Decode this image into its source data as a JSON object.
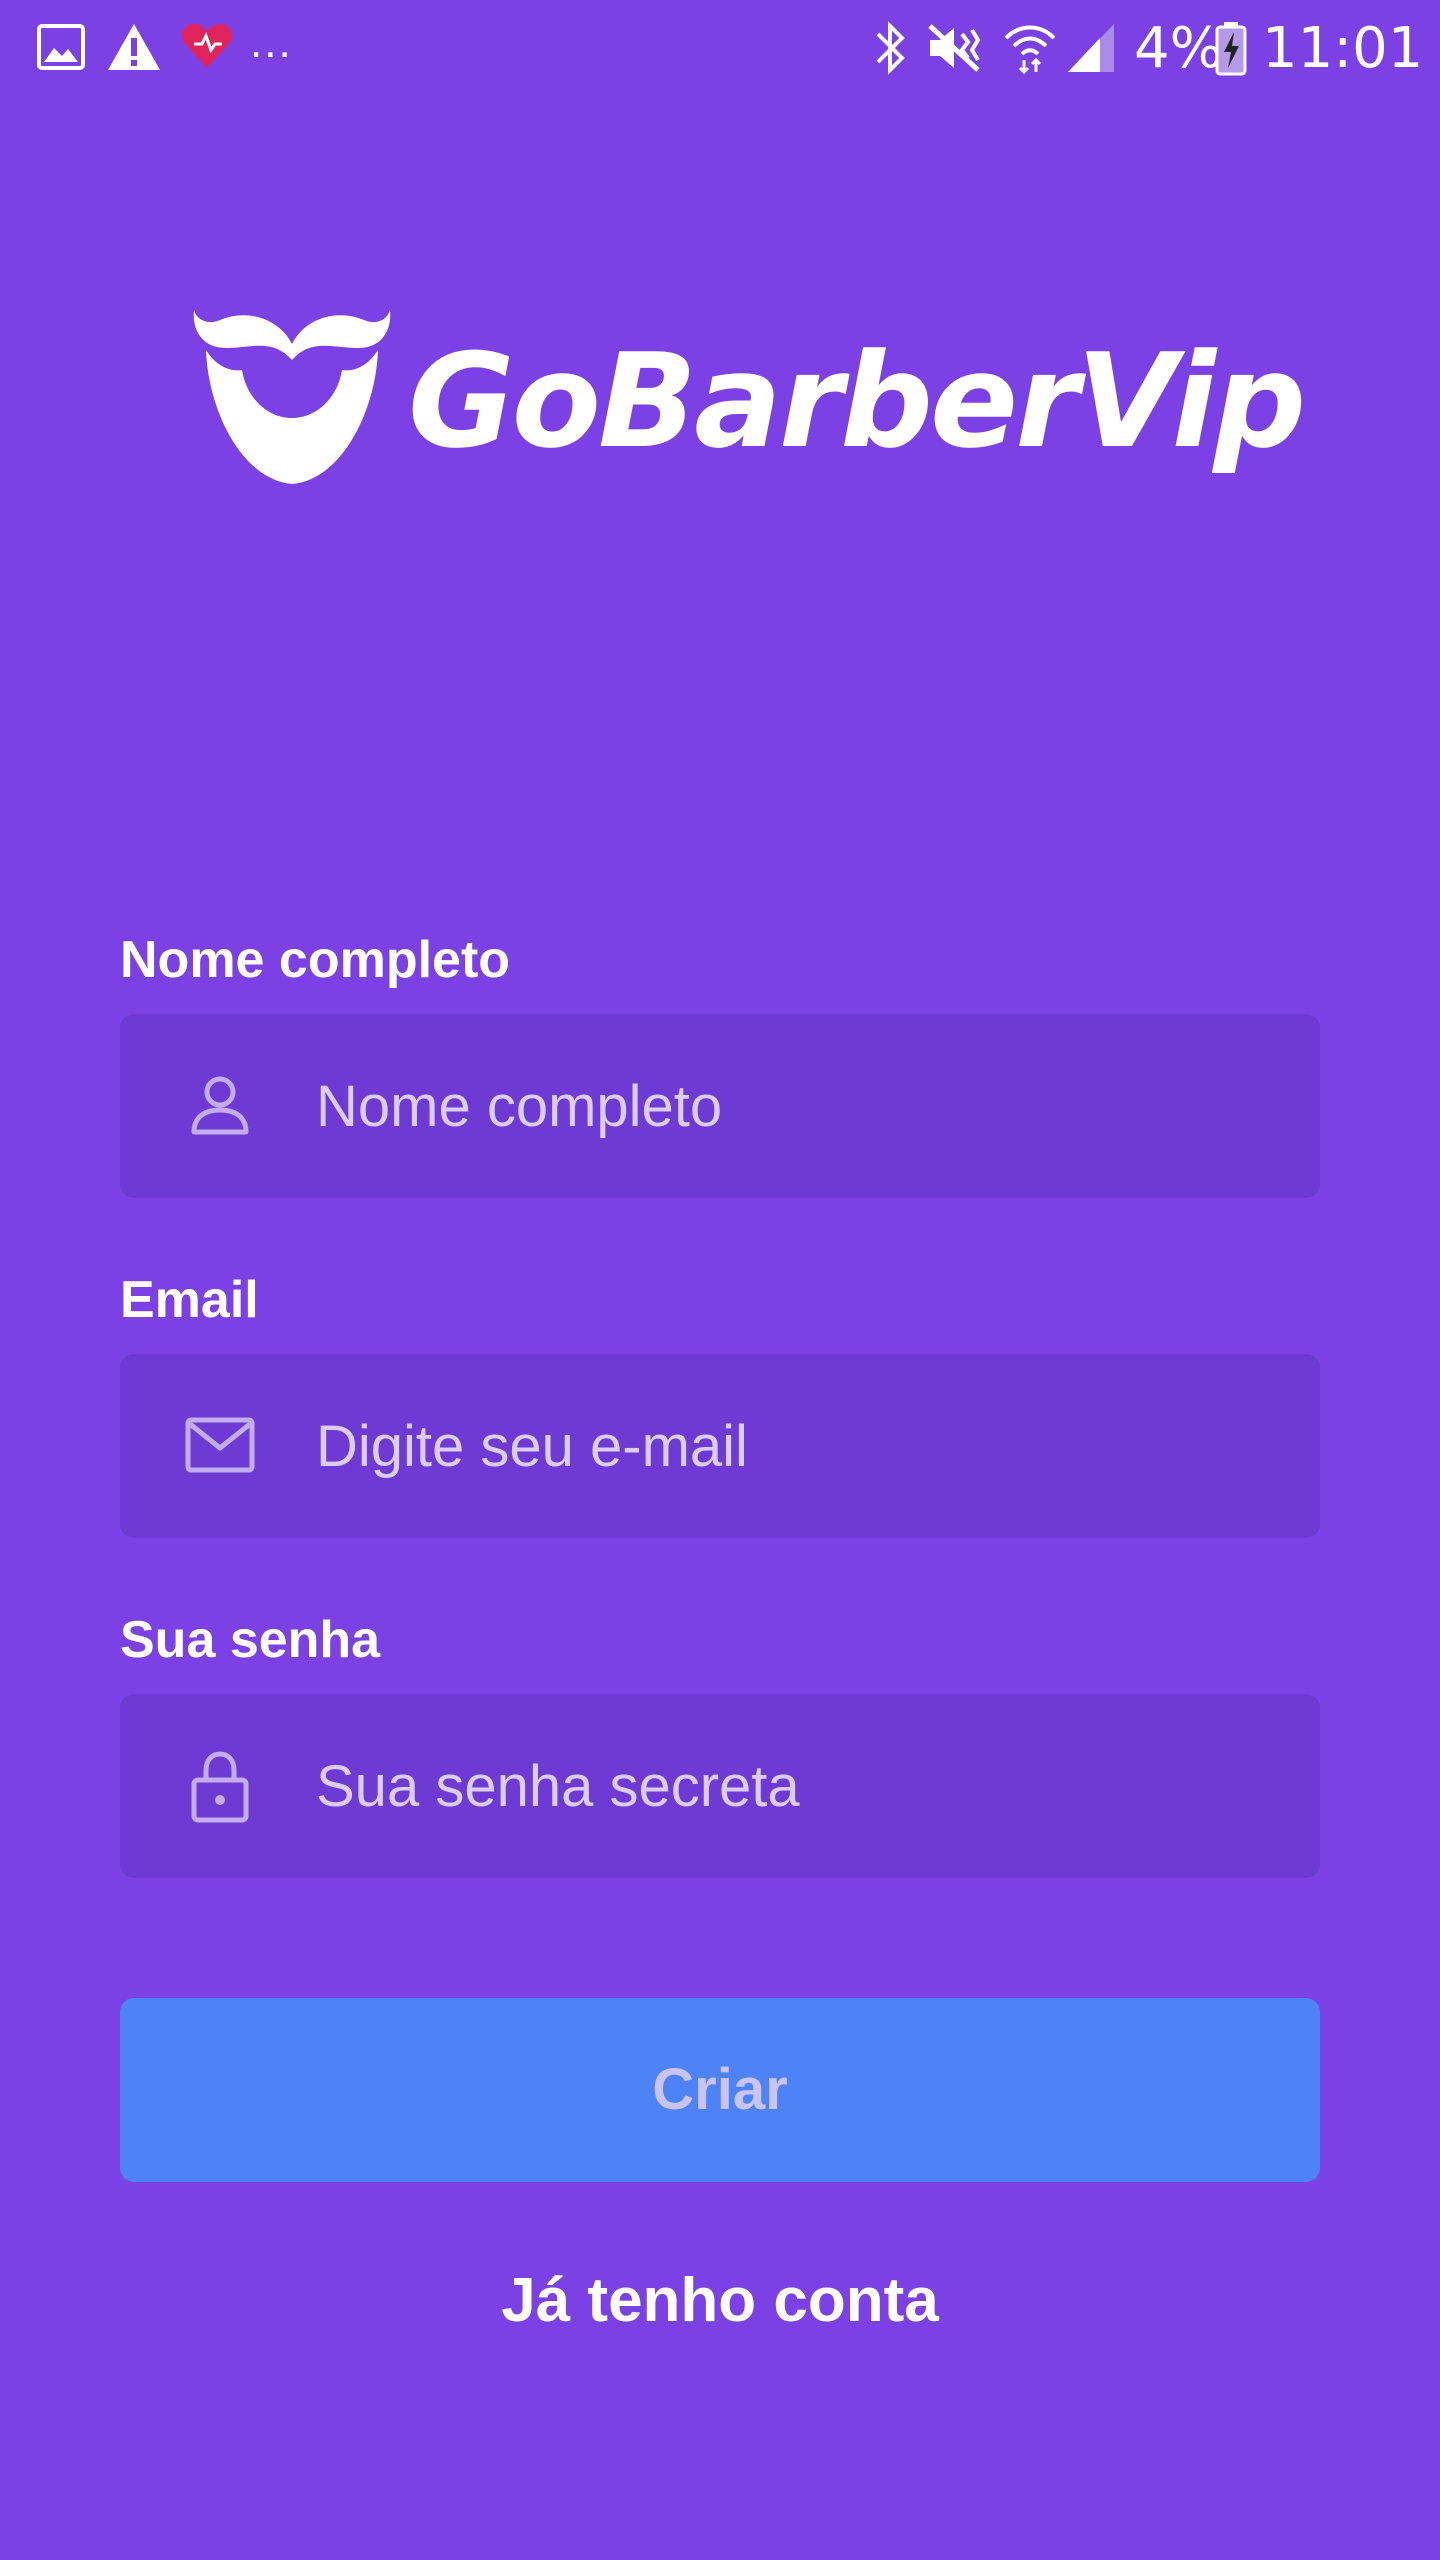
{
  "status_bar": {
    "overflow_dots": "...",
    "battery_percent": "4%",
    "time": "11:01",
    "left_icons": [
      "gallery-icon",
      "warning-icon",
      "heart-app-icon"
    ],
    "right_icons": [
      "bluetooth-icon",
      "vibrate-mute-icon",
      "wifi-icon",
      "signal-icon",
      "battery-charging-icon"
    ]
  },
  "logo": {
    "text": "GoBarberVip",
    "icon": "beard-mustache-icon"
  },
  "form": {
    "name": {
      "label": "Nome completo",
      "placeholder": "Nome completo",
      "value": "",
      "icon": "user-icon"
    },
    "email": {
      "label": "Email",
      "placeholder": "Digite seu e-mail",
      "value": "",
      "icon": "mail-icon"
    },
    "password": {
      "label": "Sua senha",
      "placeholder": "Sua senha secreta",
      "value": "",
      "icon": "lock-icon"
    },
    "submit_label": "Criar",
    "login_link_label": "Já tenho conta"
  },
  "colors": {
    "background": "#7c41e4",
    "input_background": "#6d3ad3",
    "button_background": "#4e82f7",
    "button_text": "#c9c3f6",
    "placeholder_text": "#dccdf7"
  }
}
